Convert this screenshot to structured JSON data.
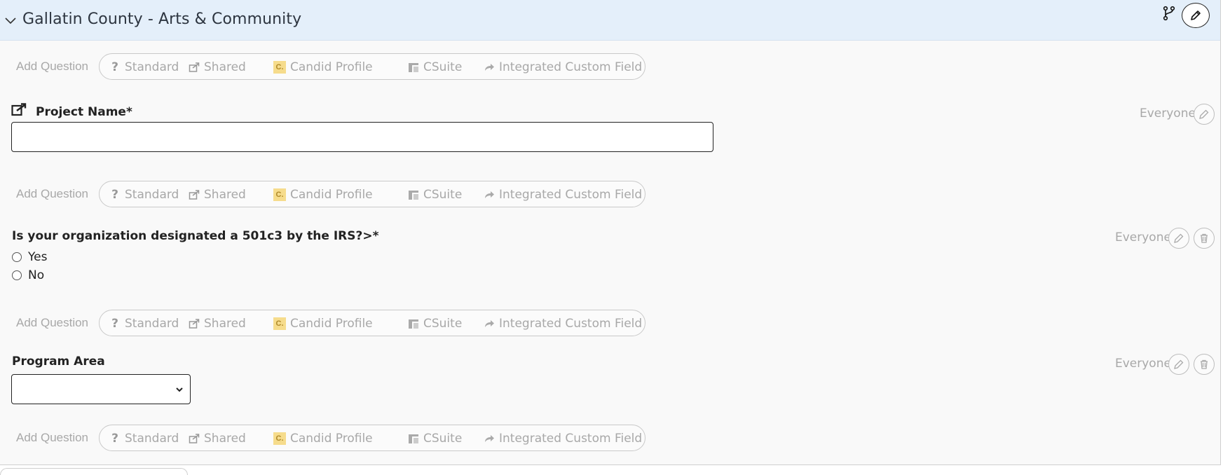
{
  "section": {
    "title": "Gallatin County - Arts & Community"
  },
  "add_question": {
    "label": "Add Question",
    "options": [
      {
        "label": "Standard",
        "icon": "question-icon"
      },
      {
        "label": "Shared",
        "icon": "share-icon"
      },
      {
        "label": "Candid Profile",
        "icon": "candid-icon",
        "badge": "C."
      },
      {
        "label": "CSuite",
        "icon": "csuite-icon"
      },
      {
        "label": "Integrated Custom Field",
        "icon": "forward-icon"
      }
    ]
  },
  "questions": [
    {
      "title": "Project Name*",
      "audience": "Everyone",
      "type": "text",
      "value": ""
    },
    {
      "title": "Is your organization designated a 501c3 by the IRS?>*",
      "audience": "Everyone",
      "type": "radio",
      "options": [
        "Yes",
        "No"
      ]
    },
    {
      "title": "Program Area",
      "audience": "Everyone",
      "type": "select",
      "value": ""
    }
  ],
  "colors": {
    "header_bg": "#e4effa",
    "panel_bg": "#f9f9f9",
    "muted_text": "#a8a8a8",
    "candid_badge": "#f6dc8c"
  }
}
